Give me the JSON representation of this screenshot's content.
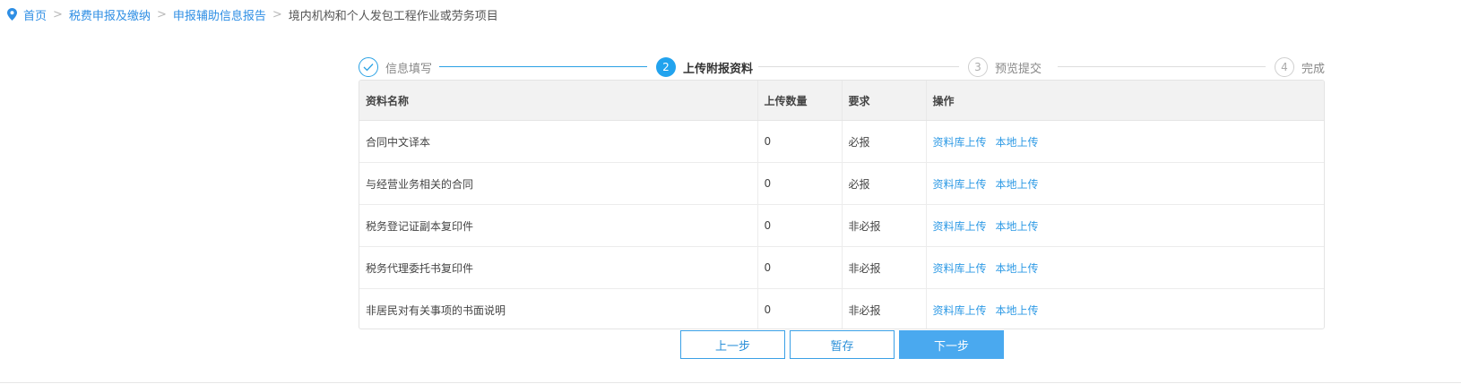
{
  "breadcrumb": {
    "home": "首页",
    "level1": "税费申报及缴纳",
    "level2": "申报辅助信息报告",
    "current": "境内机构和个人发包工程作业或劳务项目",
    "separator": ">"
  },
  "steps": [
    {
      "number": "",
      "label": "信息填写",
      "status": "done"
    },
    {
      "number": "2",
      "label": "上传附报资料",
      "status": "active"
    },
    {
      "number": "3",
      "label": "预览提交",
      "status": "todo"
    },
    {
      "number": "4",
      "label": "完成",
      "status": "todo"
    }
  ],
  "table": {
    "headers": [
      "资料名称",
      "上传数量",
      "要求",
      "操作"
    ],
    "rows": [
      {
        "name": "合同中文译本",
        "count": "0",
        "requirement": "必报",
        "op1": "资料库上传",
        "op2": "本地上传"
      },
      {
        "name": "与经营业务相关的合同",
        "count": "0",
        "requirement": "必报",
        "op1": "资料库上传",
        "op2": "本地上传"
      },
      {
        "name": "税务登记证副本复印件",
        "count": "0",
        "requirement": "非必报",
        "op1": "资料库上传",
        "op2": "本地上传"
      },
      {
        "name": "税务代理委托书复印件",
        "count": "0",
        "requirement": "非必报",
        "op1": "资料库上传",
        "op2": "本地上传"
      },
      {
        "name": "非居民对有关事项的书面说明",
        "count": "0",
        "requirement": "非必报",
        "op1": "资料库上传",
        "op2": "本地上传"
      }
    ]
  },
  "buttons": {
    "prev": "上一步",
    "save": "暂存",
    "next": "下一步"
  },
  "colors": {
    "accent": "#22a3ee",
    "link": "#2e8ee4",
    "primary_button": "#4aa9ef"
  },
  "icons": {
    "breadcrumb": "location-pin-icon",
    "step_done": "check-icon"
  }
}
